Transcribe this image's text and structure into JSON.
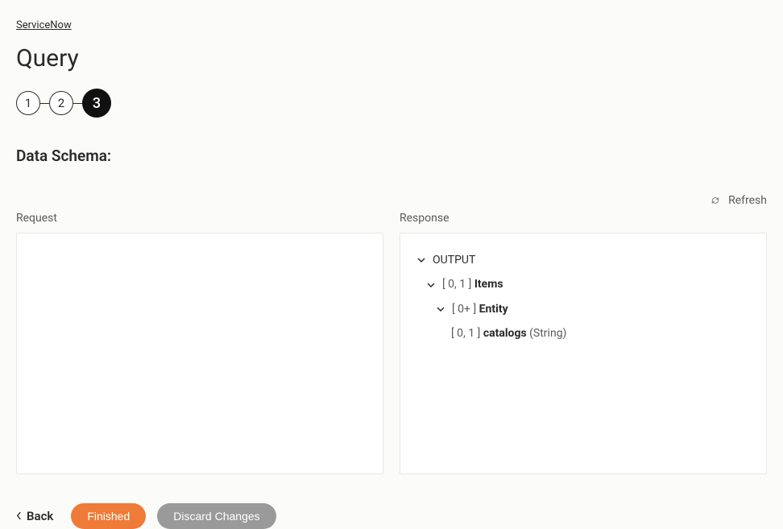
{
  "breadcrumb": "ServiceNow",
  "page_title": "Query",
  "stepper": {
    "steps": [
      "1",
      "2",
      "3"
    ],
    "active_index": 2
  },
  "section_title": "Data Schema:",
  "refresh_label": "Refresh",
  "request": {
    "label": "Request"
  },
  "response": {
    "label": "Response",
    "tree": {
      "root": "OUTPUT",
      "items_card": "[ 0, 1 ]",
      "items_label": "Items",
      "entity_card": "[ 0+ ]",
      "entity_label": "Entity",
      "catalogs_card": "[ 0, 1 ]",
      "catalogs_label": "catalogs",
      "catalogs_type": "(String)"
    }
  },
  "footer": {
    "back": "Back",
    "finished": "Finished",
    "discard": "Discard Changes"
  }
}
